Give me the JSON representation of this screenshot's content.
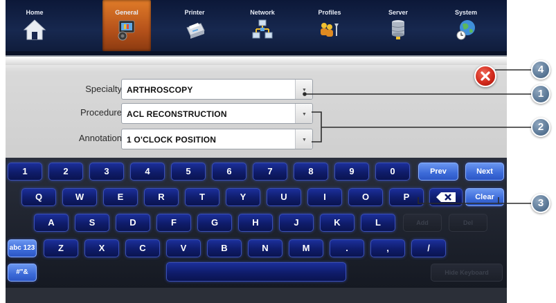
{
  "nav": {
    "items": [
      {
        "label": "Home",
        "icon": "house-icon"
      },
      {
        "label": "General",
        "icon": "speaker-monitor-icon",
        "active": true
      },
      {
        "label": "Printer",
        "icon": "printer-icon"
      },
      {
        "label": "Network",
        "icon": "network-icon"
      },
      {
        "label": "Profiles",
        "icon": "profiles-icon"
      },
      {
        "label": "Server",
        "icon": "server-icon"
      },
      {
        "label": "System",
        "icon": "globe-clock-icon"
      }
    ],
    "active_color": "#d4691f"
  },
  "form": {
    "specialty": {
      "label": "Specialty",
      "value": "ARTHROSCOPY"
    },
    "procedure": {
      "label": "Procedure",
      "value": "ACL RECONSTRUCTION"
    },
    "annotation": {
      "label": "Annotation",
      "value": "1 O'CLOCK POSITION"
    }
  },
  "keyboard": {
    "row1": [
      "1",
      "2",
      "3",
      "4",
      "5",
      "6",
      "7",
      "8",
      "9",
      "0"
    ],
    "row2": [
      "Q",
      "W",
      "E",
      "R",
      "T",
      "Y",
      "U",
      "I",
      "O",
      "P"
    ],
    "row3": [
      "A",
      "S",
      "D",
      "F",
      "G",
      "H",
      "J",
      "K",
      "L"
    ],
    "row4": [
      "Z",
      "X",
      "C",
      "V",
      "B",
      "N",
      "M",
      ".",
      ",",
      "/"
    ],
    "prev": "Prev",
    "next": "Next",
    "clear": "Clear",
    "add": "Add",
    "del": "Del",
    "abc": "abc 123",
    "symbols": "#\"&",
    "hide": "Hide Keyboard"
  },
  "callouts": [
    "4",
    "1",
    "2",
    "3"
  ],
  "colors": {
    "close": "#d22a1c",
    "key": "#0f1c6a",
    "key_light": "#3c6ad8",
    "callout": "#5d7a98"
  }
}
